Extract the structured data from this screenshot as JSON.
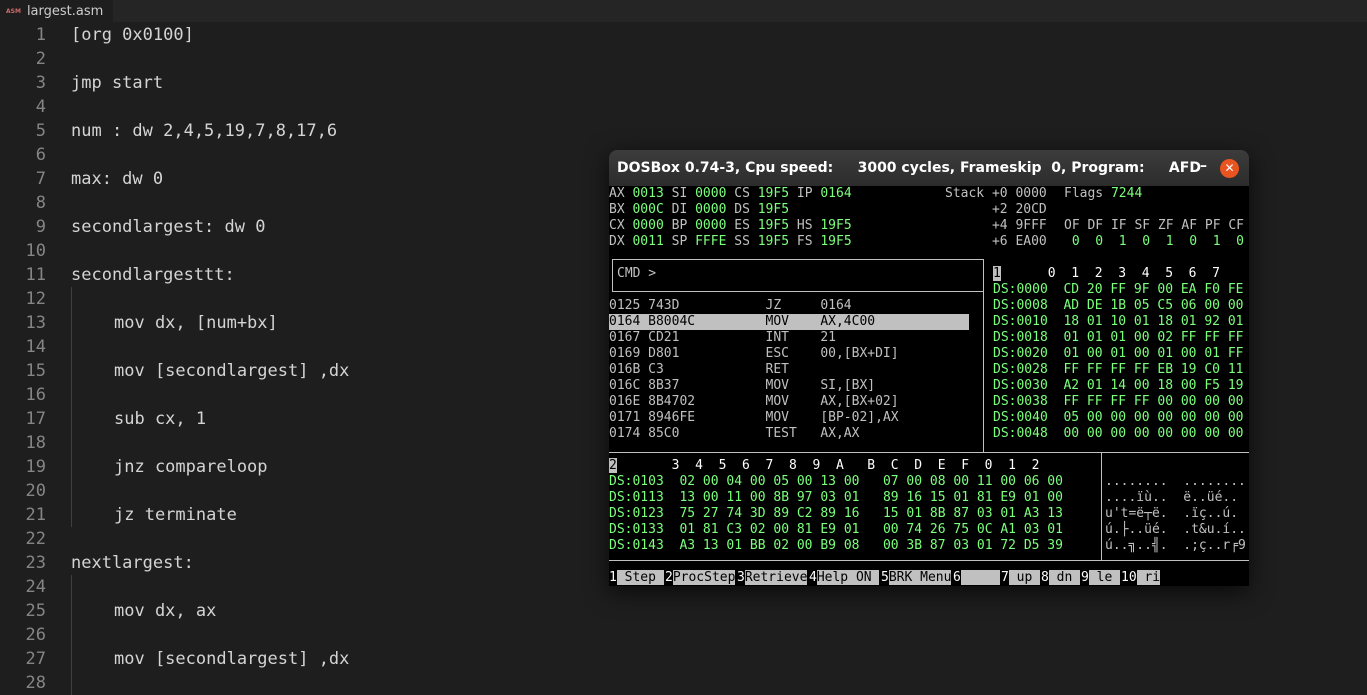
{
  "editor": {
    "tab": {
      "icon": "asm-file-icon",
      "icon_text": "ASM",
      "label": "largest.asm"
    },
    "lines": [
      {
        "n": "1",
        "text": "[org 0x0100]",
        "indent": 0
      },
      {
        "n": "2",
        "text": "",
        "indent": 0
      },
      {
        "n": "3",
        "text": "jmp start",
        "indent": 0
      },
      {
        "n": "4",
        "text": "",
        "indent": 0
      },
      {
        "n": "5",
        "text": "num : dw 2,4,5,19,7,8,17,6",
        "indent": 0
      },
      {
        "n": "6",
        "text": "",
        "indent": 0
      },
      {
        "n": "7",
        "text": "max: dw 0",
        "indent": 0
      },
      {
        "n": "8",
        "text": "",
        "indent": 0
      },
      {
        "n": "9",
        "text": "secondlargest: dw 0",
        "indent": 0
      },
      {
        "n": "10",
        "text": "",
        "indent": 0
      },
      {
        "n": "11",
        "text": "secondlargesttt:",
        "indent": 0
      },
      {
        "n": "12",
        "text": "",
        "indent": 0
      },
      {
        "n": "13",
        "text": "mov dx, [num+bx]",
        "indent": 1
      },
      {
        "n": "14",
        "text": "",
        "indent": 0
      },
      {
        "n": "15",
        "text": "mov [secondlargest] ,dx",
        "indent": 1
      },
      {
        "n": "16",
        "text": "",
        "indent": 0
      },
      {
        "n": "17",
        "text": "sub cx, 1",
        "indent": 1
      },
      {
        "n": "18",
        "text": "",
        "indent": 0
      },
      {
        "n": "19",
        "text": "jnz compareloop",
        "indent": 1
      },
      {
        "n": "20",
        "text": "",
        "indent": 0
      },
      {
        "n": "21",
        "text": "jz terminate",
        "indent": 1
      },
      {
        "n": "22",
        "text": "",
        "indent": 0
      },
      {
        "n": "23",
        "text": "nextlargest:",
        "indent": 0
      },
      {
        "n": "24",
        "text": "",
        "indent": 0
      },
      {
        "n": "25",
        "text": "mov dx, ax",
        "indent": 1
      },
      {
        "n": "26",
        "text": "",
        "indent": 0
      },
      {
        "n": "27",
        "text": "mov [secondlargest] ,dx",
        "indent": 1
      },
      {
        "n": "28",
        "text": "",
        "indent": 0
      }
    ]
  },
  "dosbox": {
    "title": "DOSBox 0.74-3, Cpu speed:     3000 cycles, Frameskip  0, Program:     AFD",
    "minimize_label": "–",
    "close_label": "✕",
    "registers": [
      [
        {
          "l": "AX ",
          "v": "0013"
        },
        {
          "l": " SI ",
          "v": "0000"
        },
        {
          "l": " CS ",
          "v": "19F5"
        },
        {
          "l": " IP ",
          "v": "0164"
        }
      ],
      [
        {
          "l": "BX ",
          "v": "000C"
        },
        {
          "l": " DI ",
          "v": "0000"
        },
        {
          "l": " DS ",
          "v": "19F5"
        }
      ],
      [
        {
          "l": "CX ",
          "v": "0000"
        },
        {
          "l": " BP ",
          "v": "0000"
        },
        {
          "l": " ES ",
          "v": "19F5"
        },
        {
          "l": " HS ",
          "v": "19F5"
        }
      ],
      [
        {
          "l": "DX ",
          "v": "0011"
        },
        {
          "l": " SP ",
          "v": "FFFE"
        },
        {
          "l": " SS ",
          "v": "19F5"
        },
        {
          "l": " FS ",
          "v": "19F5"
        }
      ]
    ],
    "stack": [
      {
        "off": "Stack +0",
        "val": "0000"
      },
      {
        "off": "+2",
        "val": "20CD"
      },
      {
        "off": "+4",
        "val": "9FFF"
      },
      {
        "off": "+6",
        "val": "EA00"
      }
    ],
    "flags_label": "Flags",
    "flags_value": "7244",
    "flag_names": "OF DF IF SF ZF AF PF CF",
    "flag_values": " 0  0  1  0  1  0  1  0",
    "cmd_prompt": "CMD >",
    "disasm": [
      {
        "addr": "0125",
        "bytes": "743D",
        "mn": "JZ",
        "op": "0164",
        "sel": false
      },
      {
        "addr": "0164",
        "bytes": "B8004C",
        "mn": "MOV",
        "op": "AX,4C00",
        "sel": true
      },
      {
        "addr": "0167",
        "bytes": "CD21",
        "mn": "INT",
        "op": "21",
        "sel": false
      },
      {
        "addr": "0169",
        "bytes": "D801",
        "mn": "ESC",
        "op": "00,[BX+DI]",
        "sel": false
      },
      {
        "addr": "016B",
        "bytes": "C3",
        "mn": "RET",
        "op": "",
        "sel": false
      },
      {
        "addr": "016C",
        "bytes": "8B37",
        "mn": "MOV",
        "op": "SI,[BX]",
        "sel": false
      },
      {
        "addr": "016E",
        "bytes": "8B4702",
        "mn": "MOV",
        "op": "AX,[BX+02]",
        "sel": false
      },
      {
        "addr": "0171",
        "bytes": "8946FE",
        "mn": "MOV",
        "op": "[BP-02],AX",
        "sel": false
      },
      {
        "addr": "0174",
        "bytes": "85C0",
        "mn": "TEST",
        "op": "AX,AX",
        "sel": false
      }
    ],
    "mem1_header_index": "1",
    "mem1_header_cols": "  0  1  2  3  4  5  6  7",
    "mem1": [
      {
        "addr": "DS:0000",
        "bytes": "CD 20 FF 9F 00 EA F0 FE"
      },
      {
        "addr": "DS:0008",
        "bytes": "AD DE 1B 05 C5 06 00 00"
      },
      {
        "addr": "DS:0010",
        "bytes": "18 01 10 01 18 01 92 01"
      },
      {
        "addr": "DS:0018",
        "bytes": "01 01 01 00 02 FF FF FF"
      },
      {
        "addr": "DS:0020",
        "bytes": "01 00 01 00 01 00 01 FF"
      },
      {
        "addr": "DS:0028",
        "bytes": "FF FF FF FF EB 19 C0 11"
      },
      {
        "addr": "DS:0030",
        "bytes": "A2 01 14 00 18 00 F5 19"
      },
      {
        "addr": "DS:0038",
        "bytes": "FF FF FF FF 00 00 00 00"
      },
      {
        "addr": "DS:0040",
        "bytes": "05 00 00 00 00 00 00 00"
      },
      {
        "addr": "DS:0048",
        "bytes": "00 00 00 00 00 00 00 00"
      }
    ],
    "mem2_header_index": "2",
    "mem2_header_cols": "  3  4  5  6  7  8  9  A   B  C  D  E  F  0  1  2",
    "mem2": [
      {
        "addr": "DS:0103",
        "bytes": "02 00 04 00 05 00 13 00   07 00 08 00 11 00 06 00",
        "ascii": "........  ........"
      },
      {
        "addr": "DS:0113",
        "bytes": "13 00 11 00 8B 97 03 01   89 16 15 01 81 E9 01 00",
        "ascii": "....ïù..  ë..üé.."
      },
      {
        "addr": "DS:0123",
        "bytes": "75 27 74 3D 89 C2 89 16   15 01 8B 87 03 01 A3 13",
        "ascii": "u't=ë┬ë.  .ïç..ú."
      },
      {
        "addr": "DS:0133",
        "bytes": "01 81 C3 02 00 81 E9 01   00 74 26 75 0C A1 03 01",
        "ascii": "ú.├..üé.  .t&u.í.."
      },
      {
        "addr": "DS:0143",
        "bytes": "A3 13 01 BB 02 00 B9 08   00 3B 87 03 01 72 D5 39",
        "ascii": "ú..╗..╣.  .;ç..r╒9"
      }
    ],
    "fkeys": [
      {
        "n": "1",
        "label": " Step "
      },
      {
        "n": "2",
        "label": "ProcStep"
      },
      {
        "n": "3",
        "label": "Retrieve"
      },
      {
        "n": "4",
        "label": "Help ON "
      },
      {
        "n": "5",
        "label": "BRK Menu"
      },
      {
        "n": "6",
        "label": "     "
      },
      {
        "n": "7",
        "label": " up "
      },
      {
        "n": "8",
        "label": " dn "
      },
      {
        "n": "9",
        "label": " le "
      },
      {
        "n": "10",
        "label": " ri"
      }
    ]
  }
}
